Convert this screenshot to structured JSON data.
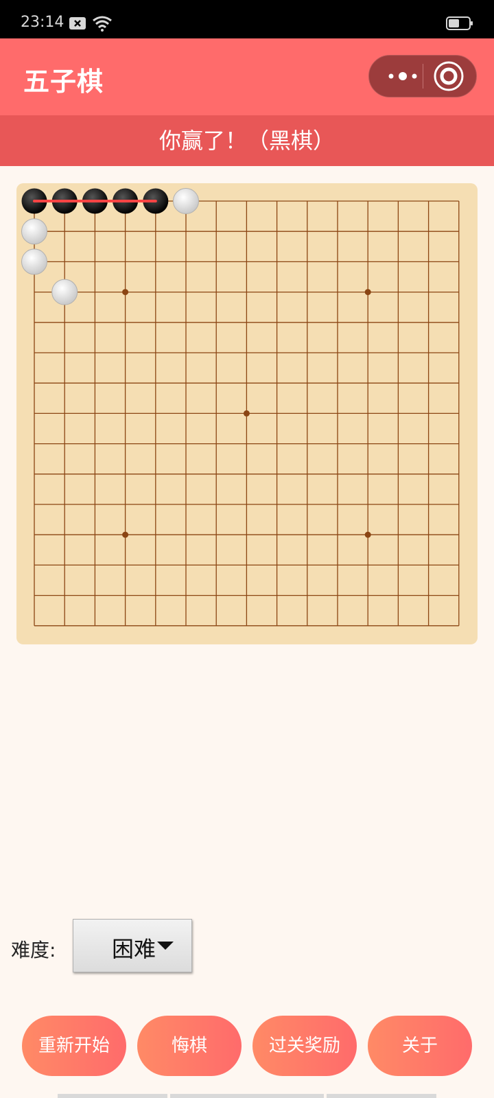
{
  "status_bar": {
    "time": "23:14"
  },
  "nav": {
    "title": "五子棋"
  },
  "result": {
    "message": "你赢了！（黑棋）"
  },
  "board": {
    "size": 15,
    "star_points": [
      [
        3,
        3
      ],
      [
        11,
        3
      ],
      [
        7,
        7
      ],
      [
        3,
        11
      ],
      [
        11,
        11
      ]
    ],
    "black_stones": [
      [
        0,
        0
      ],
      [
        1,
        0
      ],
      [
        2,
        0
      ],
      [
        3,
        0
      ],
      [
        4,
        0
      ]
    ],
    "white_stones": [
      [
        5,
        0
      ],
      [
        0,
        1
      ],
      [
        0,
        2
      ],
      [
        1,
        3
      ]
    ],
    "winning_line": [
      [
        0,
        0
      ],
      [
        4,
        0
      ]
    ],
    "colors": {
      "board": "#f5deb3",
      "grid": "#8b4513",
      "win_line": "#ff4444"
    }
  },
  "difficulty": {
    "label": "难度:",
    "value": "困难"
  },
  "actions": {
    "restart": "重新开始",
    "undo": "悔棋",
    "reward": "过关奖励",
    "about": "关于"
  },
  "colors": {
    "nav": "#ff6b6b",
    "result_bar": "#e85757",
    "background": "#fef7f1"
  }
}
